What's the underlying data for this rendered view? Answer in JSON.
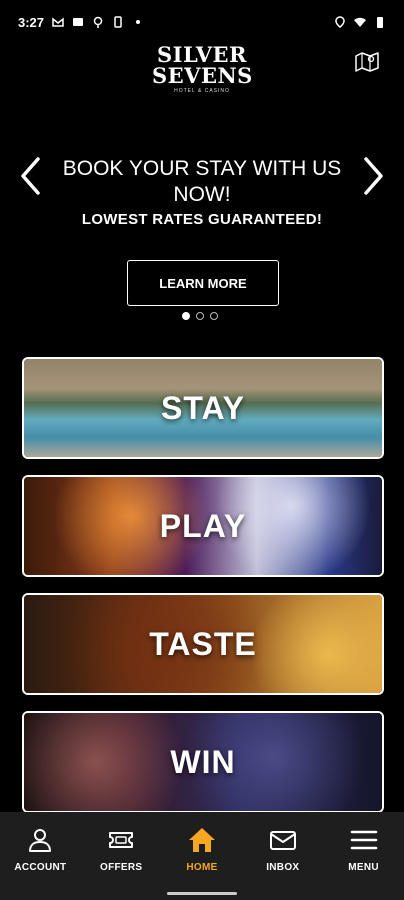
{
  "status_bar": {
    "time": "3:27",
    "left_icons": [
      "gmail-icon",
      "message-icon",
      "location-pin-icon",
      "phone-icon",
      "dot-icon"
    ],
    "right_icons": [
      "location-icon",
      "wifi-icon",
      "battery-icon"
    ]
  },
  "header": {
    "logo_line1": "SILVER",
    "logo_line2": "SEVENS",
    "logo_sub": "HOTEL & CASINO",
    "map_icon": "map-icon"
  },
  "banner": {
    "title": "BOOK YOUR STAY WITH US NOW!",
    "subtitle": "LOWEST RATES GUARANTEED!",
    "button_label": "LEARN MORE",
    "pagination": {
      "total": 3,
      "active": 1
    }
  },
  "cards": [
    {
      "label": "STAY"
    },
    {
      "label": "PLAY"
    },
    {
      "label": "TASTE"
    },
    {
      "label": "WIN"
    }
  ],
  "bottom_nav": {
    "items": [
      {
        "label": "ACCOUNT",
        "icon": "person-icon",
        "active": false
      },
      {
        "label": "OFFERS",
        "icon": "ticket-icon",
        "active": false
      },
      {
        "label": "HOME",
        "icon": "home-icon",
        "active": true
      },
      {
        "label": "INBOX",
        "icon": "mail-icon",
        "active": false
      },
      {
        "label": "MENU",
        "icon": "hamburger-icon",
        "active": false
      }
    ],
    "active_color": "#f5a623"
  }
}
